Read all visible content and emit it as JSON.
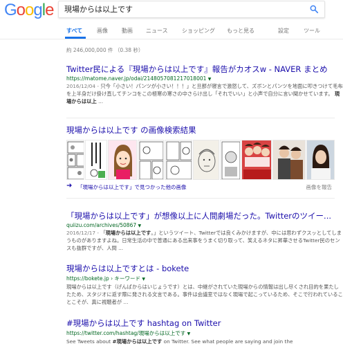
{
  "logo": "Google",
  "search": {
    "query": "現場からは以上です"
  },
  "tabs": [
    {
      "label": "すべて"
    },
    {
      "label": "画像"
    },
    {
      "label": "動画"
    },
    {
      "label": "ニュース"
    },
    {
      "label": "ショッピング"
    },
    {
      "label": "もっと見る"
    },
    {
      "label": "設定"
    },
    {
      "label": "ツール"
    }
  ],
  "stats": "約 246,000,000 件  （0.38 秒）",
  "results": [
    {
      "title": "Twitter民による『現場からは以上です』報告がカオスw - NAVER まとめ",
      "url": "https://matome.naver.jp/odai/2148057081217018001",
      "date": "2016/12/04 - ",
      "snippet": "只今「小さい！パンツが小さい！！！」と旦那が寝言で激怒して、ズボンとパンツを地面に叩きつけて毛布を上半身だけ掛け直してチンコをこの極寒の寒さの中さらけ出し「それでいい」と小声で自分に言い聞かせています。",
      "bold": "現場からは以上",
      "tail": " ..."
    },
    {
      "title": "「現場からは以上です」が想像以上に人間劇場だった。Twitterのツイー...",
      "url": "quiizu.com/archives/50867",
      "date": "2016/12/17 - ",
      "snippet_pre": "「",
      "bold": "現場からは以上です",
      "snippet": "。」というツイート、Twitterでは良くみかけますが、中には思わずクスッとしてしまうものがありますよね。日常生活の中で普通にある出来事をうまく切り取って、笑えるネタに昇華させるTwitter民のセンスも抜群ですが、人間 ..."
    },
    {
      "title": "現場からは以上ですとは - bokete",
      "url": "https://bokete.jp › キーワード",
      "snippet": "現場からは以上です（げんばからはいじょうです）とは、中継がされていた現場からの情報は出し尽くされ目的を果たしたため、スタジオに返す際に発される文言である。事件は会議室ではなく現場で起こっているため、そこで行われていることこそが、真に視聴者が ..."
    },
    {
      "title": "#現場からは以上です hashtag on Twitter",
      "url": "https://twitter.com/hashtag/現場からは以上です",
      "snippet_pre": "See Tweets about ",
      "bold": "#現場からは以上です",
      "snippet": " on Twitter. See what people are saying and join the"
    }
  ],
  "images": {
    "title": "現場からは以上です の画像検索結果",
    "more_link": "「現場からは以上です」で見つかった他の画像",
    "report": "画像を報告"
  },
  "colors": {
    "link": "#1a0dab",
    "url": "#006621",
    "snippet": "#545454",
    "active_tab": "#1a73e8"
  }
}
